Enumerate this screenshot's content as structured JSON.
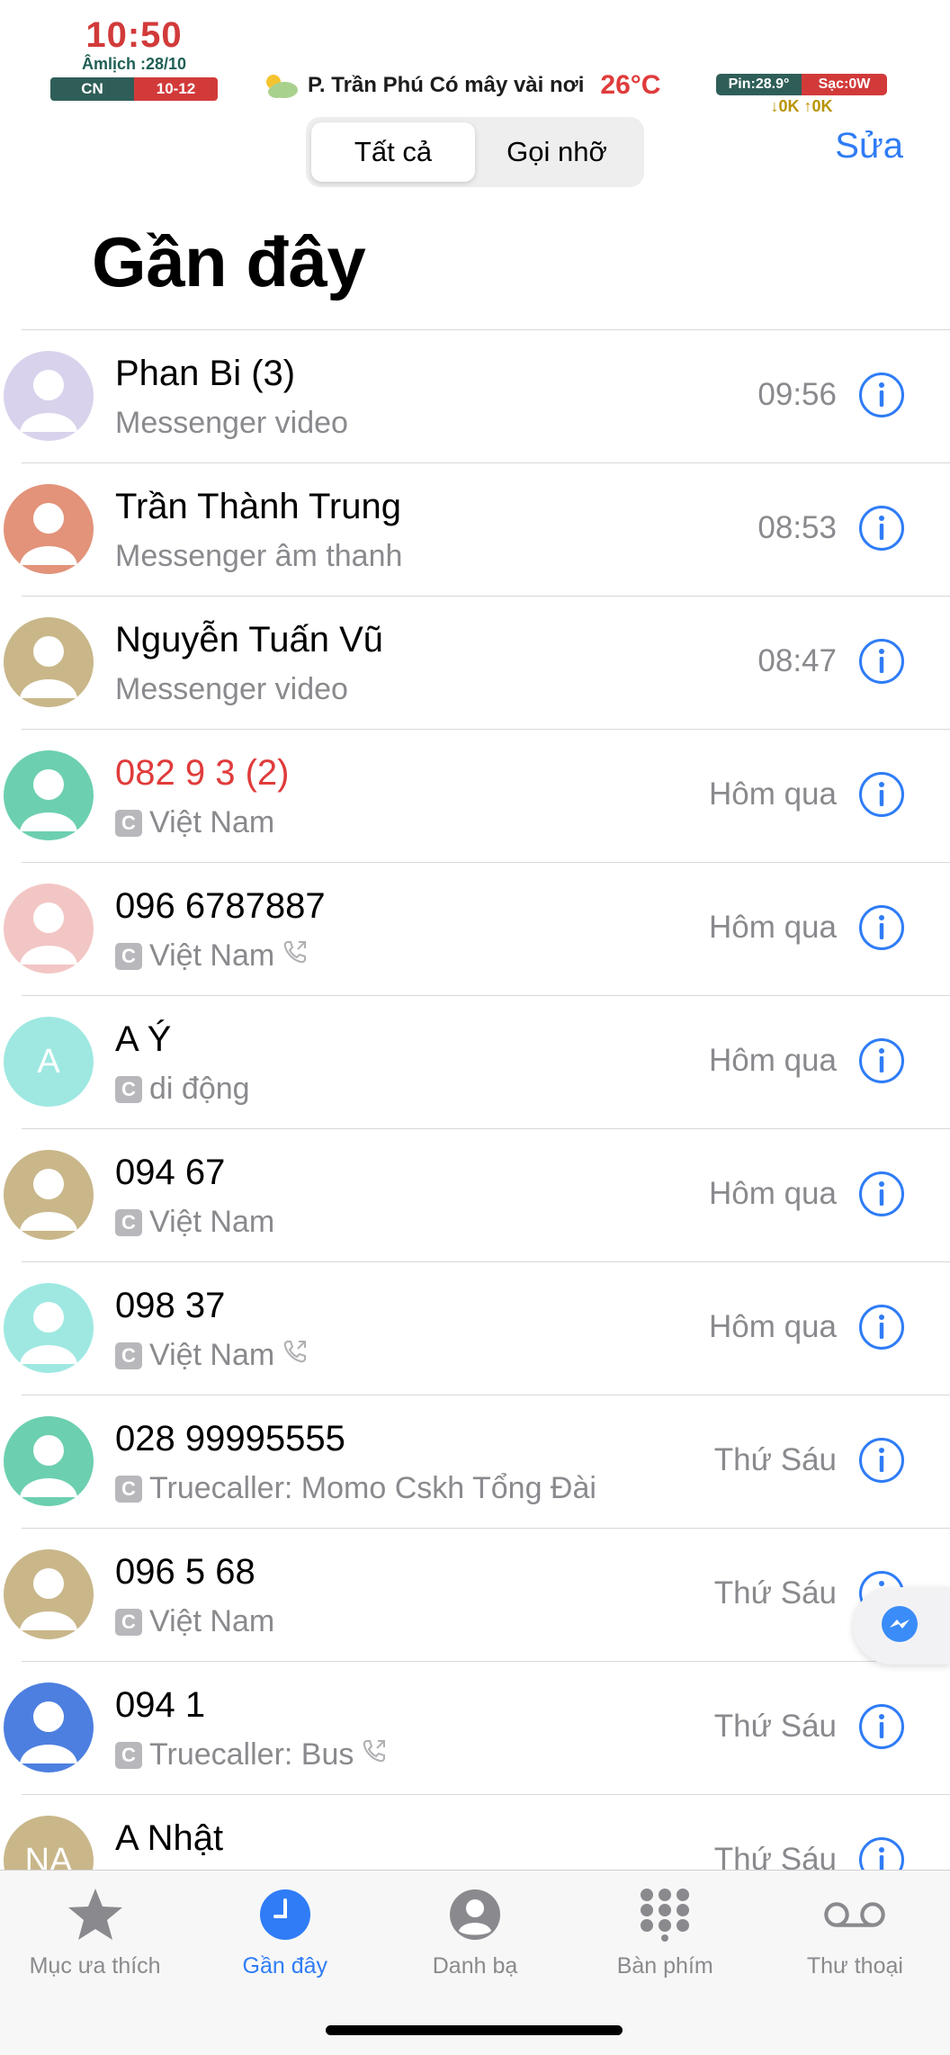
{
  "status_widget": {
    "time": "10:50",
    "lunar": "Âmlịch :28/10",
    "day": "CN",
    "date": "10-12",
    "weather_text": "P. Trần Phú Có mây vài nơi",
    "temperature": "26°C",
    "battery": "Pin:28.9°",
    "charging": "Sạc:0W",
    "speed": "↓0K ↑0K"
  },
  "segment": {
    "all": "Tất cả",
    "missed": "Gọi nhỡ",
    "selected": "all"
  },
  "edit_label": "Sửa",
  "page_title": "Gần đây",
  "calls": [
    {
      "name": "Phan Bi (3)",
      "sub": "Messenger video",
      "time": "09:56",
      "missed": false,
      "badge": false,
      "phone_icon": false,
      "avatar_color": "#d9d2ec",
      "initials": ""
    },
    {
      "name": "Trần Thành Trung",
      "sub": "Messenger âm thanh",
      "time": "08:53",
      "missed": false,
      "badge": false,
      "phone_icon": false,
      "avatar_color": "#e2937a",
      "initials": ""
    },
    {
      "name": "Nguyễn Tuấn Vũ",
      "sub": "Messenger video",
      "time": "08:47",
      "missed": false,
      "badge": false,
      "phone_icon": false,
      "avatar_color": "#c9b78a",
      "initials": ""
    },
    {
      "name": "082 9     3 (2)",
      "sub": "Việt Nam",
      "time": "Hôm qua",
      "missed": true,
      "badge": true,
      "phone_icon": false,
      "avatar_color": "#6ccfb0",
      "initials": ""
    },
    {
      "name": "096 6787887",
      "sub": "Việt Nam",
      "time": "Hôm qua",
      "missed": false,
      "badge": true,
      "phone_icon": true,
      "avatar_color": "#f2c6c4",
      "initials": ""
    },
    {
      "name": "A Ý",
      "sub": "di động",
      "time": "Hôm qua",
      "missed": false,
      "badge": true,
      "phone_icon": false,
      "avatar_color": "#9fe8e2",
      "initials": "A"
    },
    {
      "name": "094      67",
      "sub": "Việt Nam",
      "time": "Hôm qua",
      "missed": false,
      "badge": true,
      "phone_icon": false,
      "avatar_color": "#c9b78a",
      "initials": ""
    },
    {
      "name": "098      37",
      "sub": "Việt Nam",
      "time": "Hôm qua",
      "missed": false,
      "badge": true,
      "phone_icon": true,
      "avatar_color": "#9fe8e2",
      "initials": ""
    },
    {
      "name": "028 99995555",
      "sub": "Truecaller: Momo Cskh Tổng Đài",
      "time": "Thứ Sáu",
      "missed": false,
      "badge": true,
      "phone_icon": false,
      "avatar_color": "#6ccfb0",
      "initials": ""
    },
    {
      "name": "096 5     68",
      "sub": "Việt Nam",
      "time": "Thứ Sáu",
      "missed": false,
      "badge": true,
      "phone_icon": false,
      "avatar_color": "#c9b78a",
      "initials": ""
    },
    {
      "name": "094      1",
      "sub": "Truecaller: Bus",
      "time": "Thứ Sáu",
      "missed": false,
      "badge": true,
      "phone_icon": true,
      "avatar_color": "#4d7fe0",
      "initials": ""
    },
    {
      "name": "A Nhật",
      "sub": "",
      "time": "Thứ Sáu",
      "missed": false,
      "badge": false,
      "phone_icon": false,
      "avatar_color": "#c9b78a",
      "initials": "NA"
    }
  ],
  "badge_letter": "C",
  "tabs": [
    {
      "label": "Mục ưa thích",
      "icon": "star-icon",
      "active": false
    },
    {
      "label": "Gần đây",
      "icon": "clock-icon",
      "active": true
    },
    {
      "label": "Danh bạ",
      "icon": "person-circle-icon",
      "active": false
    },
    {
      "label": "Bàn phím",
      "icon": "keypad-icon",
      "active": false
    },
    {
      "label": "Thư thoại",
      "icon": "voicemail-icon",
      "active": false
    }
  ],
  "colors": {
    "accent": "#2f7cf6",
    "missed": "#e03b3b",
    "secondary_text": "#8a8a8e"
  }
}
